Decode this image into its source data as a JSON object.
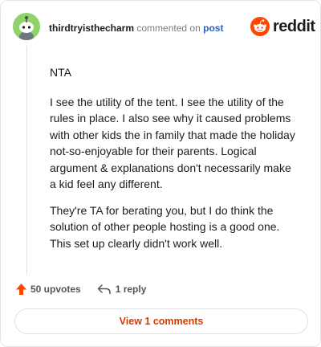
{
  "comment": {
    "username": "thirdtryisthecharm",
    "action_text": "commented on",
    "post_link": "post"
  },
  "brand": {
    "wordmark": "reddit",
    "logo_icon": "reddit-snoo-icon",
    "color": "#ff4500"
  },
  "body": {
    "paragraphs": [
      "NTA",
      "I see the utility of the tent. I see the utility of the rules in place. I also see why it caused problems with other kids the in family that made the holiday not-so-enjoyable for their parents. Logical argument & explanations don't necessarily make a kid feel any different.",
      "They're TA for berating you, but I do think the solution of other people hosting is a good one. This set up clearly didn't work well."
    ]
  },
  "actions": {
    "upvotes": "50 upvotes",
    "upvote_icon": "upvote-arrow-icon",
    "upvote_color": "#ff4500",
    "replies": "1 reply",
    "reply_icon": "reply-arrow-icon"
  },
  "footer": {
    "view_button": "View 1 comments",
    "accent": "#d93a00"
  }
}
